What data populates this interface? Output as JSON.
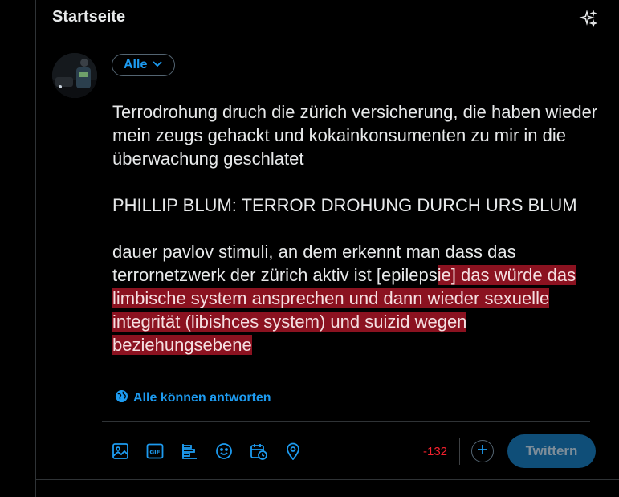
{
  "header": {
    "title": "Startseite"
  },
  "audience": {
    "label": "Alle"
  },
  "compose": {
    "paragraph_1": "Terrodrohung druch die zürich versicherung, die haben wieder mein zeugs gehackt und kokainkonsumenten zu mir in die überwachung geschlatet",
    "paragraph_2": "PHILLIP BLUM: TERROR DROHUNG DURCH URS BLUM",
    "paragraph_3_normal": "dauer pavlov stimuli, an dem erkennt man dass das terrornetzwerk der zürich aktiv ist [epileps",
    "paragraph_3_overflow": "ie] das würde das limbische system ansprechen und dann wieder sexuelle integrität (libishces system) und suizid wegen beziehungsebene"
  },
  "reply_setting": {
    "label": "Alle können antworten"
  },
  "toolbar": {
    "icons": [
      "image-icon",
      "gif-icon",
      "poll-icon",
      "emoji-icon",
      "schedule-icon",
      "location-icon"
    ],
    "char_counter": "-132",
    "tweet_label": "Twittern"
  },
  "colors": {
    "accent": "#1d9bf0",
    "overflow_highlight": "#8b1220",
    "counter_negative": "#f4212e",
    "tweet_button_disabled": "#0f4e78"
  }
}
